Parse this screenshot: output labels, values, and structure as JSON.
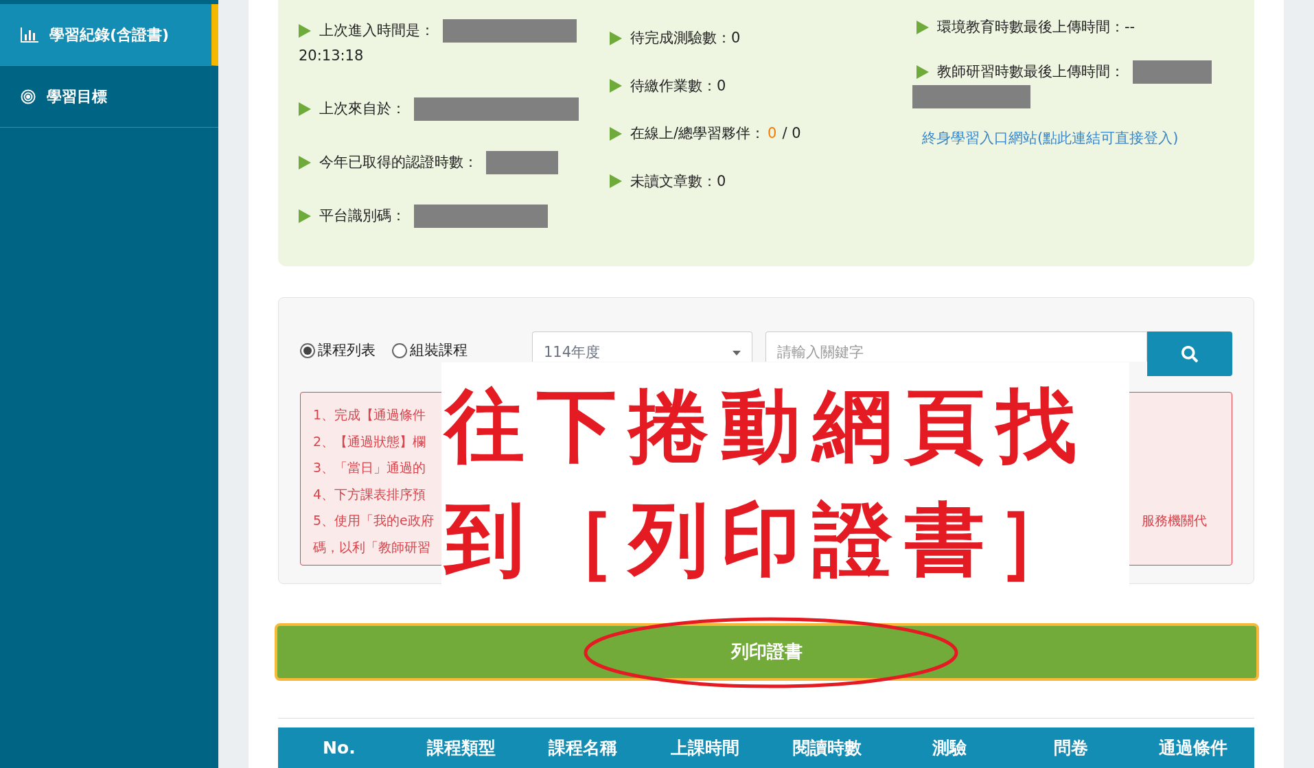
{
  "sidebar": {
    "items": [
      {
        "label": "學習紀錄(含證書)",
        "selected": true
      },
      {
        "label": "學習目標",
        "selected": false
      }
    ]
  },
  "info": {
    "columns": [
      [
        {
          "label": "上次進入時間是：",
          "value": "20:13:18"
        },
        {
          "label": "上次來自於："
        },
        {
          "label": "今年已取得的認證時數："
        },
        {
          "label": "平台識別碼："
        }
      ],
      [
        {
          "label": "待完成測驗數：0"
        },
        {
          "label": "待繳作業數：0"
        },
        {
          "label": "在線上/總學習夥伴：",
          "online": "0",
          "total": "/ 0"
        },
        {
          "label": "未讀文章數：0"
        }
      ],
      [
        {
          "label": "環境教育時數最後上傳時間：--"
        },
        {
          "label": "教師研習時數最後上傳時間："
        }
      ]
    ],
    "link": "終身學習入口網站(點此連結可直接登入)"
  },
  "filter": {
    "radios": [
      {
        "label": "課程列表",
        "selected": true
      },
      {
        "label": "組裝課程",
        "selected": false
      }
    ],
    "year_select": "114年度",
    "search": {
      "placeholder": "請輸入關鍵字"
    },
    "notes": [
      {
        "left": "1、完成【通過條件"
      },
      {
        "left": "2、【通過狀態】欄"
      },
      {
        "left": "3、「當日」通過的"
      },
      {
        "left": "4、下方課表排序預"
      },
      {
        "left": "5、使用「我的e政府",
        "right": "服務機關代"
      },
      {
        "left": "碼，以利「教師研習"
      }
    ]
  },
  "annotation": {
    "lines": [
      "往下捲動網頁找",
      "到［列印證書］"
    ]
  },
  "print_button": "列印證書",
  "table": {
    "columns": [
      "No.",
      "課程類型",
      "課程名稱",
      "上課時間",
      "閱讀時數",
      "測驗",
      "問卷",
      "通過條件"
    ]
  }
}
